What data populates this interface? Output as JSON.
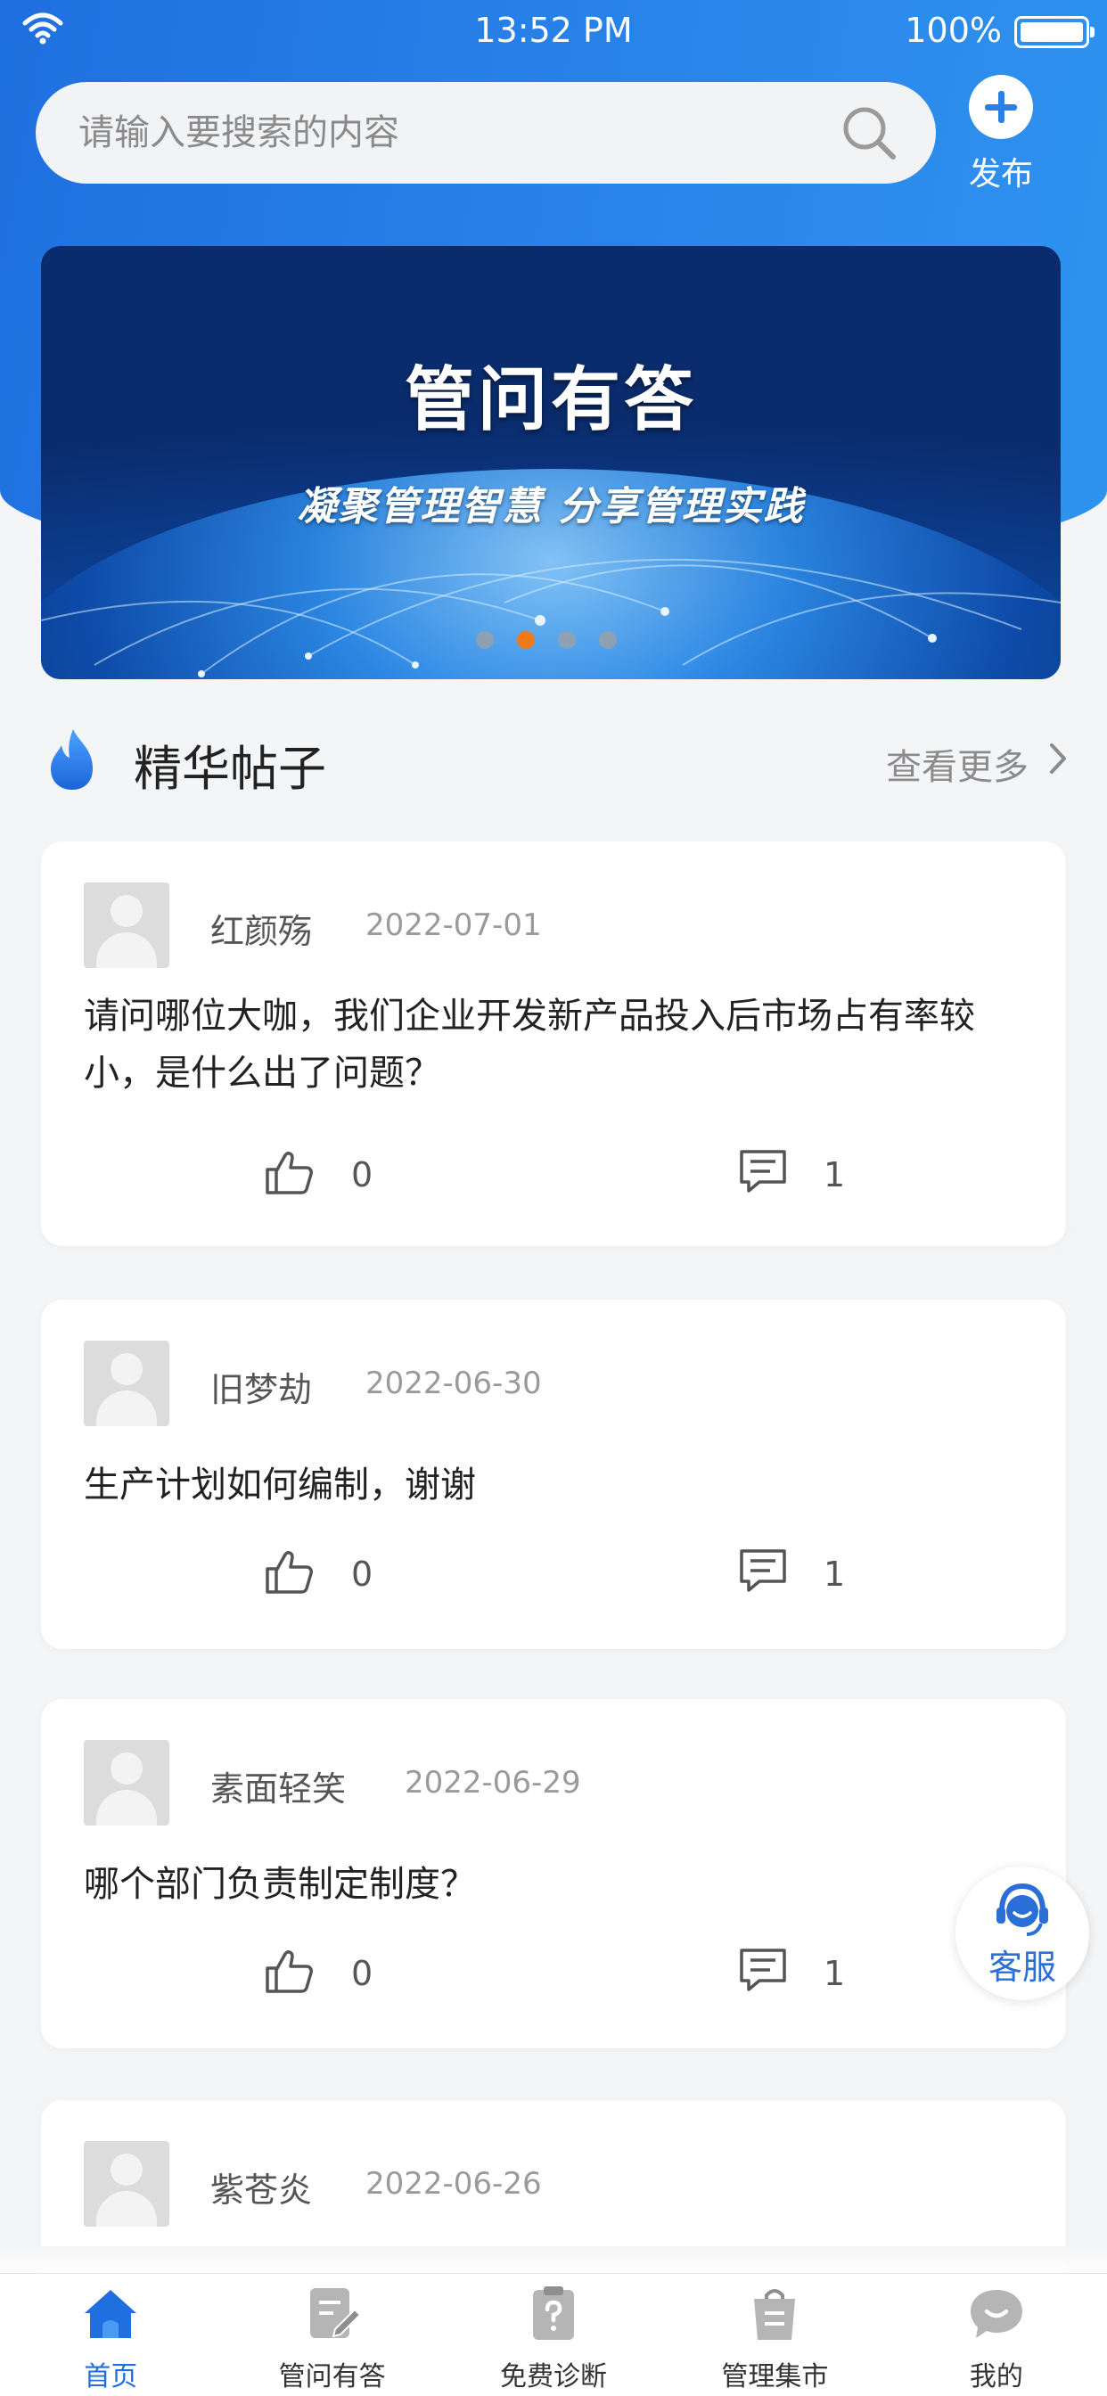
{
  "status_bar": {
    "time": "13:52 PM",
    "battery": "100%"
  },
  "search": {
    "placeholder": "请输入要搜索的内容"
  },
  "publish": {
    "label": "发布"
  },
  "banner": {
    "title": "管问有答",
    "subtitle": "凝聚管理智慧  分享管理实践",
    "page_count": 4,
    "active_index": 1
  },
  "section": {
    "title": "精华帖子",
    "more_label": "查看更多"
  },
  "posts": [
    {
      "user": "红颜殇",
      "date": "2022-07-01",
      "content": "请问哪位大咖，我们企业开发新产品投入后市场占有率较小，是什么出了问题？",
      "likes": "0",
      "comments": "1"
    },
    {
      "user": "旧梦劫",
      "date": "2022-06-30",
      "content": "生产计划如何编制，谢谢",
      "likes": "0",
      "comments": "1"
    },
    {
      "user": "素面轻笑",
      "date": "2022-06-29",
      "content": "哪个部门负责制定制度？",
      "likes": "0",
      "comments": "1"
    },
    {
      "user": "紫苍炎",
      "date": "2022-06-26"
    }
  ],
  "service_float": {
    "label": "客服"
  },
  "tabbar": {
    "active": 0,
    "accent": "#1f6fe0",
    "inactive_color": "#b5b5b5",
    "items": [
      {
        "label": "首页",
        "icon": "home-icon"
      },
      {
        "label": "管问有答",
        "icon": "edit-note-icon"
      },
      {
        "label": "免费诊断",
        "icon": "question-clipboard-icon"
      },
      {
        "label": "管理集市",
        "icon": "shopping-bag-icon"
      },
      {
        "label": "我的",
        "icon": "chat-face-icon"
      }
    ]
  },
  "colors": {
    "header_blue": "#2a86ea",
    "banner_dot_active": "#f07a1a",
    "service_blue": "#2a6fd8"
  }
}
